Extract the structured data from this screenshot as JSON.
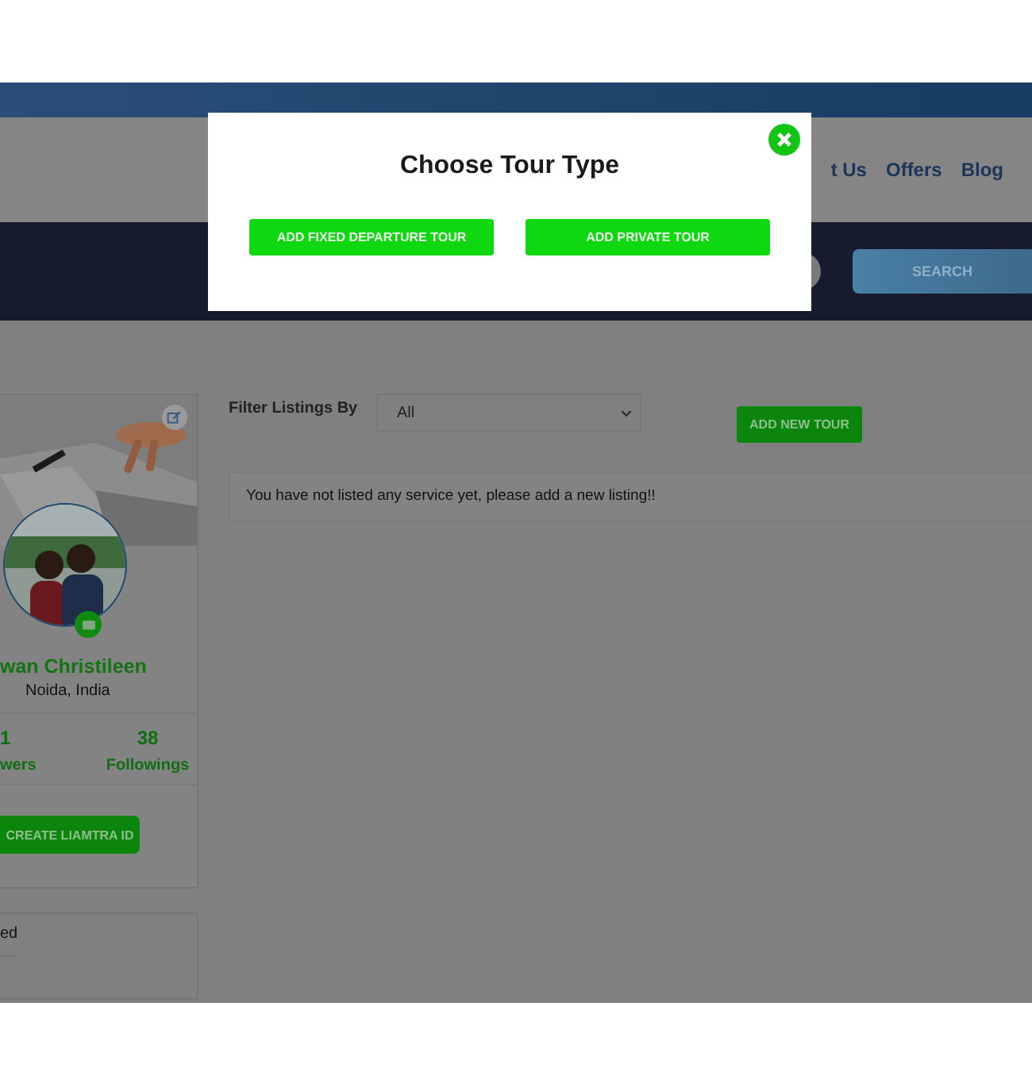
{
  "top_nav": {
    "links": [
      "t Us",
      "Offers",
      "Blog"
    ]
  },
  "search_bar": {
    "button": "SEARCH"
  },
  "profile": {
    "name": "wan Christileen",
    "location": "Noida, India",
    "stats": [
      {
        "value": "1",
        "label": "wers"
      },
      {
        "value": "38",
        "label": "Followings"
      }
    ],
    "button": "CREATE LIAMTRA ID"
  },
  "side_menu": [
    "ed"
  ],
  "listings": {
    "filter_label": "Filter Listings By",
    "filter": {
      "value": "All"
    },
    "add_button": "ADD NEW TOUR",
    "message": "You have not listed any service yet, please add a new listing!!"
  },
  "modal": {
    "title": "Choose Tour Type",
    "buttons": [
      "ADD FIXED DEPARTURE TOUR",
      "ADD PRIVATE TOUR"
    ]
  }
}
